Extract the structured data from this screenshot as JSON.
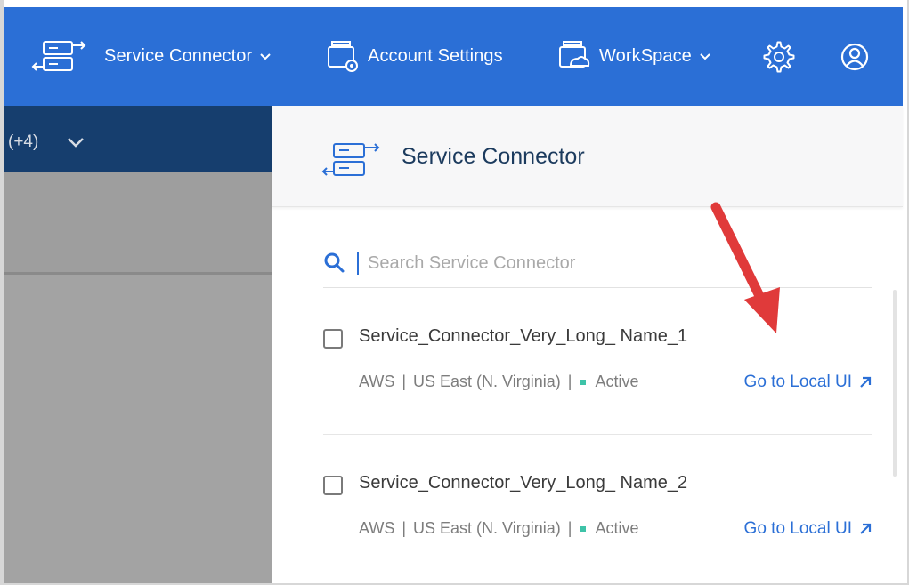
{
  "nav": {
    "service_connector_label": "Service Connector",
    "account_settings_label": "Account Settings",
    "workspace_label": "WorkSpace",
    "icons": {
      "connector": "service-connector-icon",
      "account": "account-settings-icon",
      "workspace": "workspace-icon",
      "settings": "gear-icon",
      "user": "user-icon"
    }
  },
  "left_panel": {
    "filter_text": "(+4)"
  },
  "panel": {
    "title": "Service Connector",
    "search_placeholder": "Search Service Connector",
    "connectors": [
      {
        "name": "Service_Connector_Very_Long_ Name_1",
        "provider": "AWS",
        "region": "US East (N. Virginia)",
        "status": "Active",
        "link_label": "Go to Local UI"
      },
      {
        "name": "Service_Connector_Very_Long_ Name_2",
        "provider": "AWS",
        "region": "US East (N. Virginia)",
        "status": "Active",
        "link_label": "Go to Local UI"
      }
    ]
  },
  "colors": {
    "nav_bg": "#2b6fd6",
    "left_header_bg": "#163e6e",
    "link": "#2b6fd6",
    "status_active": "#3ec3a8",
    "arrow": "#e03a3a"
  }
}
